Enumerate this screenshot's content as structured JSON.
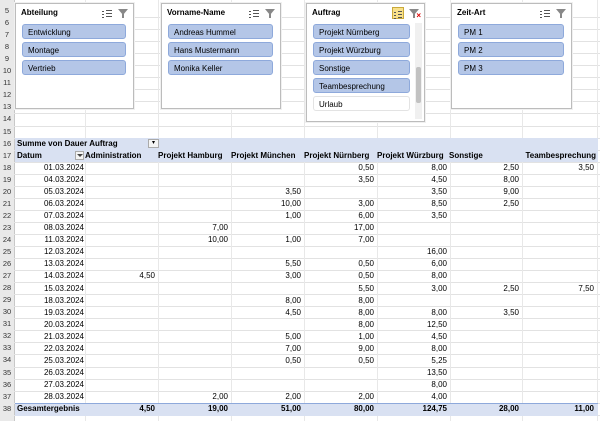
{
  "slicers": [
    {
      "title": "Abteilung",
      "filtered": false,
      "items": [
        {
          "label": "Entwicklung",
          "selected": true
        },
        {
          "label": "Montage",
          "selected": true
        },
        {
          "label": "Vertrieb",
          "selected": true
        }
      ]
    },
    {
      "title": "Vorname-Name",
      "filtered": false,
      "items": [
        {
          "label": "Andreas Hummel",
          "selected": true
        },
        {
          "label": "Hans Mustermann",
          "selected": true
        },
        {
          "label": "Monika Keller",
          "selected": true
        }
      ]
    },
    {
      "title": "Auftrag",
      "filtered": true,
      "items": [
        {
          "label": "Projekt Nürnberg",
          "selected": true
        },
        {
          "label": "Projekt Würzburg",
          "selected": true
        },
        {
          "label": "Sonstige",
          "selected": true
        },
        {
          "label": "Teambesprechung",
          "selected": true
        },
        {
          "label": "Urlaub",
          "selected": false
        }
      ]
    },
    {
      "title": "Zeit-Art",
      "filtered": false,
      "items": [
        {
          "label": "PM 1",
          "selected": true
        },
        {
          "label": "PM 2",
          "selected": true
        },
        {
          "label": "PM 3",
          "selected": true
        }
      ]
    }
  ],
  "row_numbers": [
    "5",
    "6",
    "7",
    "8",
    "9",
    "10",
    "11",
    "12",
    "13",
    "14",
    "15",
    "16",
    "17",
    "18",
    "19",
    "20",
    "21",
    "22",
    "23",
    "24",
    "25",
    "26",
    "27",
    "28",
    "29",
    "30",
    "31",
    "32",
    "33",
    "34",
    "35",
    "36",
    "37",
    "38"
  ],
  "pivot": {
    "value_field": "Summe von Dauer",
    "column_field": "Auftrag",
    "row_field": "Datum",
    "columns": [
      "Administration",
      "Projekt Hamburg",
      "Projekt München",
      "Projekt Nürnberg",
      "Projekt Würzburg",
      "Sonstige",
      "Teambesprechung"
    ],
    "rows": [
      {
        "date": "01.03.2024",
        "values": [
          "",
          "",
          "",
          "0,50",
          "8,00",
          "2,50",
          "3,50"
        ]
      },
      {
        "date": "04.03.2024",
        "values": [
          "",
          "",
          "",
          "3,50",
          "4,50",
          "8,00",
          ""
        ]
      },
      {
        "date": "05.03.2024",
        "values": [
          "",
          "",
          "3,50",
          "",
          "3,50",
          "9,00",
          ""
        ]
      },
      {
        "date": "06.03.2024",
        "values": [
          "",
          "",
          "10,00",
          "3,00",
          "8,50",
          "2,50",
          ""
        ]
      },
      {
        "date": "07.03.2024",
        "values": [
          "",
          "",
          "1,00",
          "6,00",
          "3,50",
          "",
          ""
        ]
      },
      {
        "date": "08.03.2024",
        "values": [
          "",
          "7,00",
          "",
          "17,00",
          "",
          "",
          ""
        ]
      },
      {
        "date": "11.03.2024",
        "values": [
          "",
          "10,00",
          "1,00",
          "7,00",
          "",
          "",
          ""
        ]
      },
      {
        "date": "12.03.2024",
        "values": [
          "",
          "",
          "",
          "",
          "16,00",
          "",
          ""
        ]
      },
      {
        "date": "13.03.2024",
        "values": [
          "",
          "",
          "5,50",
          "0,50",
          "6,00",
          "",
          ""
        ]
      },
      {
        "date": "14.03.2024",
        "values": [
          "4,50",
          "",
          "3,00",
          "0,50",
          "8,00",
          "",
          ""
        ]
      },
      {
        "date": "15.03.2024",
        "values": [
          "",
          "",
          "",
          "5,50",
          "3,00",
          "2,50",
          "7,50"
        ]
      },
      {
        "date": "18.03.2024",
        "values": [
          "",
          "",
          "8,00",
          "8,00",
          "",
          "",
          ""
        ]
      },
      {
        "date": "19.03.2024",
        "values": [
          "",
          "",
          "4,50",
          "8,00",
          "8,00",
          "3,50",
          ""
        ]
      },
      {
        "date": "20.03.2024",
        "values": [
          "",
          "",
          "",
          "8,00",
          "12,50",
          "",
          ""
        ]
      },
      {
        "date": "21.03.2024",
        "values": [
          "",
          "",
          "5,00",
          "1,00",
          "4,50",
          "",
          ""
        ]
      },
      {
        "date": "22.03.2024",
        "values": [
          "",
          "",
          "7,00",
          "9,00",
          "8,00",
          "",
          ""
        ]
      },
      {
        "date": "25.03.2024",
        "values": [
          "",
          "",
          "0,50",
          "0,50",
          "5,25",
          "",
          ""
        ]
      },
      {
        "date": "26.03.2024",
        "values": [
          "",
          "",
          "",
          "",
          "13,50",
          "",
          ""
        ]
      },
      {
        "date": "27.03.2024",
        "values": [
          "",
          "",
          "",
          "",
          "8,00",
          "",
          ""
        ]
      },
      {
        "date": "28.03.2024",
        "values": [
          "",
          "2,00",
          "2,00",
          "2,00",
          "4,00",
          "",
          ""
        ]
      }
    ],
    "total_label": "Gesamtergebnis",
    "totals": [
      "4,50",
      "19,00",
      "51,00",
      "80,00",
      "124,75",
      "28,00",
      "11,00"
    ]
  }
}
